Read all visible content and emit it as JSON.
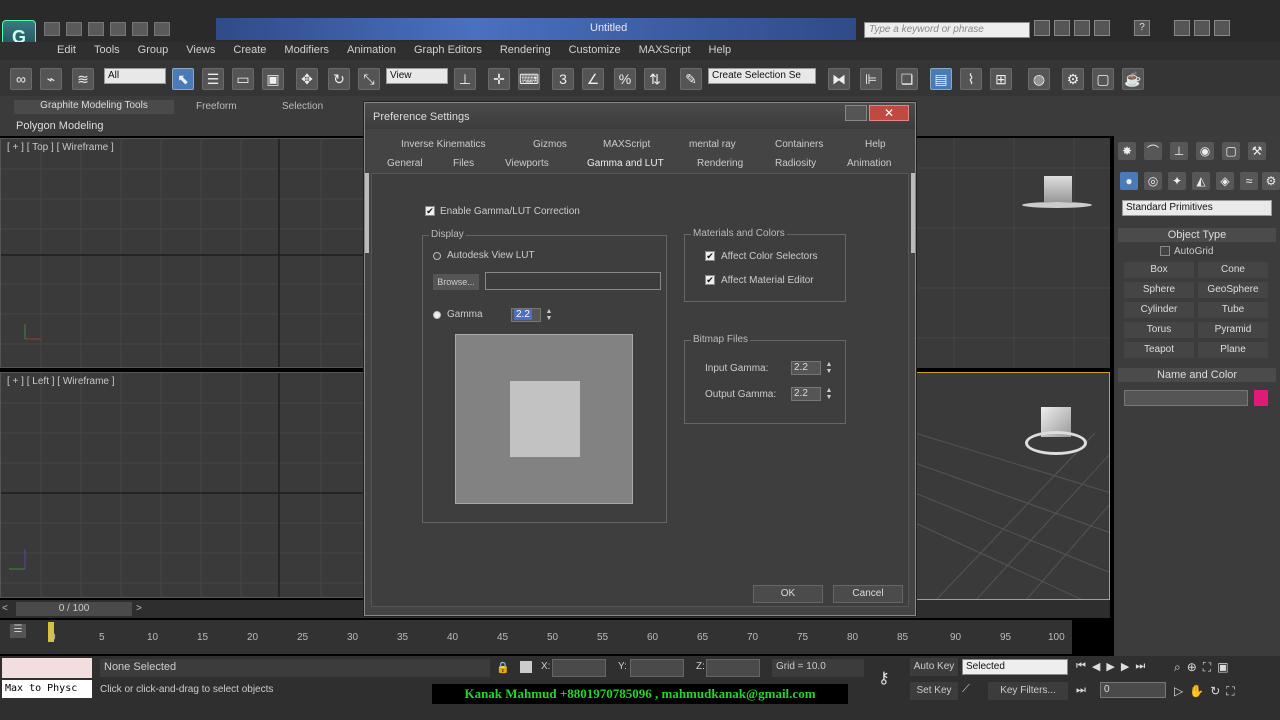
{
  "app": {
    "title": "Untitled",
    "logo_glyph": "G",
    "help_search_placeholder": "Type a keyword or phrase"
  },
  "menu": [
    "Edit",
    "Tools",
    "Group",
    "Views",
    "Create",
    "Modifiers",
    "Animation",
    "Graph Editors",
    "Rendering",
    "Customize",
    "MAXScript",
    "Help"
  ],
  "toolbar": {
    "selection_filter": "All",
    "ref_coord": "View",
    "named_selection": "Create Selection Se"
  },
  "ribbon": {
    "tabs": [
      "Graphite Modeling Tools",
      "Freeform",
      "Selection"
    ],
    "panel": "Polygon Modeling"
  },
  "viewports": {
    "top": "[ + ] [ Top ] [ Wireframe ]",
    "left": "[ + ] [ Left ] [ Wireframe ]"
  },
  "command_panel": {
    "category": "Standard Primitives",
    "object_type_title": "Object Type",
    "autogrid": "AutoGrid",
    "buttons": [
      "Box",
      "Cone",
      "Sphere",
      "GeoSphere",
      "Cylinder",
      "Tube",
      "Torus",
      "Pyramid",
      "Teapot",
      "Plane"
    ],
    "name_color_title": "Name and Color",
    "object_color": "#e0197a"
  },
  "timeline": {
    "slider": "0 / 100",
    "ticks": [
      "0",
      "5",
      "10",
      "15",
      "20",
      "25",
      "30",
      "35",
      "40",
      "45",
      "50",
      "55",
      "60",
      "65",
      "70",
      "75",
      "80",
      "85",
      "90",
      "95",
      "100"
    ]
  },
  "status": {
    "maxscript": "Max to Physc",
    "selection": "None Selected",
    "prompt": "Click or click-and-drag to select objects",
    "x_label": "X:",
    "y_label": "Y:",
    "z_label": "Z:",
    "grid": "Grid = 10.0",
    "auto_key": "Auto Key",
    "key_mode": "Selected",
    "set_key": "Set Key",
    "key_filters": "Key Filters...",
    "frame": "0",
    "credit": "Kanak Mahmud +8801970785096 , mahmudkanak@gmail.com"
  },
  "dialog": {
    "title": "Preference Settings",
    "close": "✕",
    "tabs_row1": [
      "Inverse Kinematics",
      "Gizmos",
      "MAXScript",
      "mental ray",
      "Containers",
      "Help"
    ],
    "tabs_row2": [
      "General",
      "Files",
      "Viewports",
      "Gamma and LUT",
      "Rendering",
      "Radiosity",
      "Animation"
    ],
    "enable_gamma": "Enable Gamma/LUT Correction",
    "display_group": "Display",
    "autodesk_lut": "Autodesk View LUT",
    "browse": "Browse...",
    "gamma_label": "Gamma",
    "gamma_value": "2.2",
    "materials_group": "Materials and Colors",
    "affect_color_selectors": "Affect Color Selectors",
    "affect_material_editor": "Affect Material Editor",
    "bitmap_group": "Bitmap Files",
    "input_gamma_label": "Input Gamma:",
    "input_gamma": "2.2",
    "output_gamma_label": "Output Gamma:",
    "output_gamma": "2.2",
    "ok": "OK",
    "cancel": "Cancel"
  }
}
